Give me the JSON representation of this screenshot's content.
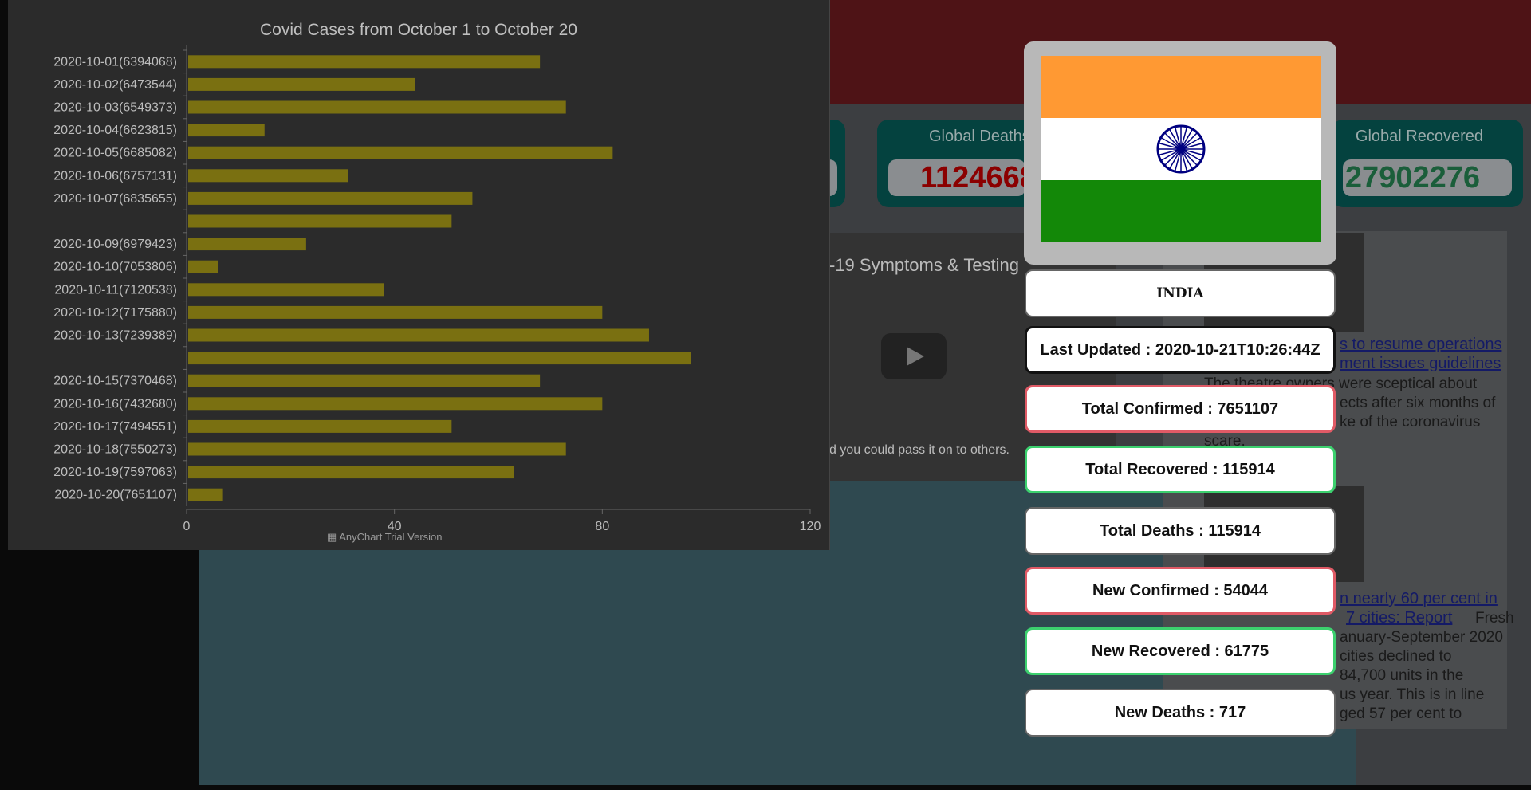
{
  "global_stats": [
    {
      "title": "Global Deaths",
      "value": "1124668",
      "color": "#8b0000"
    },
    {
      "title": "Global Recovered",
      "value": "27902276",
      "color": "#1a5e3a"
    }
  ],
  "video": {
    "title": "-19 Symptoms & Testing",
    "caption": "d you could pass it on to others."
  },
  "news": [
    {
      "link": "s to resume operations",
      "link2": "ment issues guidelines",
      "text": "The theatre owners were sceptical about",
      "text2": "ects after six months of",
      "text3": "ke of the coronavirus",
      "text4": "scare."
    },
    {
      "link": "n nearly 60 per cent in",
      "link2": "7 cities: Report",
      "text": "Fresh",
      "text2": "anuary-September 2020",
      "text3": "cities declined to",
      "text4": "84,700 units in the",
      "text5": "us year. This is in line",
      "text6": "ged 57 per cent to"
    }
  ],
  "chart_data": {
    "type": "bar",
    "orientation": "horizontal",
    "title": "Covid Cases from October 1 to October 20",
    "categories": [
      "2020-10-01(6394068)",
      "2020-10-02(6473544)",
      "2020-10-03(6549373)",
      "2020-10-04(6623815)",
      "2020-10-05(6685082)",
      "2020-10-06(6757131)",
      "2020-10-07(6835655)",
      "",
      "2020-10-09(6979423)",
      "2020-10-10(7053806)",
      "2020-10-11(7120538)",
      "2020-10-12(7175880)",
      "2020-10-13(7239389)",
      "",
      "2020-10-15(7370468)",
      "2020-10-16(7432680)",
      "2020-10-17(7494551)",
      "2020-10-18(7550273)",
      "2020-10-19(7597063)",
      "2020-10-20(7651107)"
    ],
    "values": [
      68,
      44,
      73,
      15,
      82,
      31,
      55,
      51,
      23,
      6,
      38,
      80,
      89,
      97,
      68,
      80,
      51,
      73,
      63,
      7
    ],
    "xlim": [
      0,
      120
    ],
    "xticks": [
      "0",
      "40",
      "80",
      "120"
    ],
    "bar_color": "#7a7011",
    "grid": false,
    "watermark": "AnyChart Trial Version"
  },
  "india": {
    "country": "INDIA",
    "flag_colors": {
      "saffron": "#ff9933",
      "white": "#ffffff",
      "green": "#138808",
      "chakra": "#000080"
    },
    "cards": [
      {
        "label": "Last Updated : 2020-10-21T10:26:44Z",
        "style": "black"
      },
      {
        "label": "Total Confirmed : 7651107",
        "style": "red"
      },
      {
        "label": "Total Recovered : 115914",
        "style": "green"
      },
      {
        "label": "Total Deaths : 115914",
        "style": "plain"
      },
      {
        "label": "New Confirmed : 54044",
        "style": "red"
      },
      {
        "label": "New Recovered : 61775",
        "style": "green"
      },
      {
        "label": "New Deaths : 717",
        "style": "plain"
      }
    ]
  }
}
